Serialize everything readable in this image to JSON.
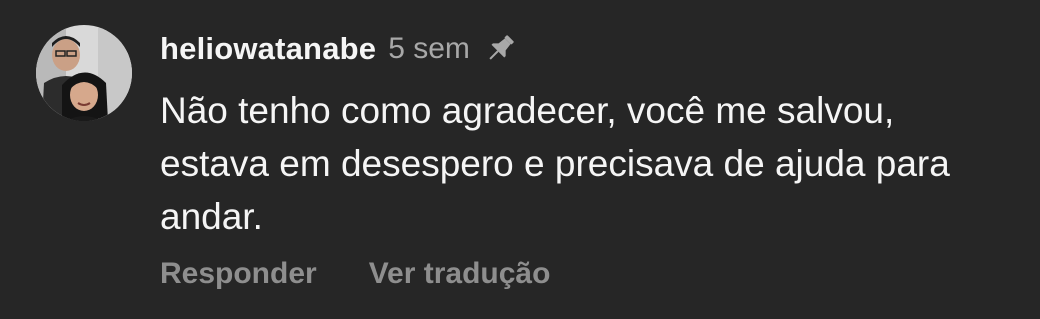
{
  "comment": {
    "username": "heliowatanabe",
    "timestamp": "5 sem",
    "pinned_icon": "pin-icon",
    "text": "Não tenho como agradecer, você me salvou, estava em desespero e precisava de ajuda para andar.",
    "avatar_icon": "avatar"
  },
  "actions": {
    "reply_label": "Responder",
    "translate_label": "Ver tradução"
  },
  "colors": {
    "background": "#262626",
    "primary_text": "#f5f5f5",
    "secondary_text": "#a8a8a8",
    "action_text": "#8e8e8e"
  }
}
